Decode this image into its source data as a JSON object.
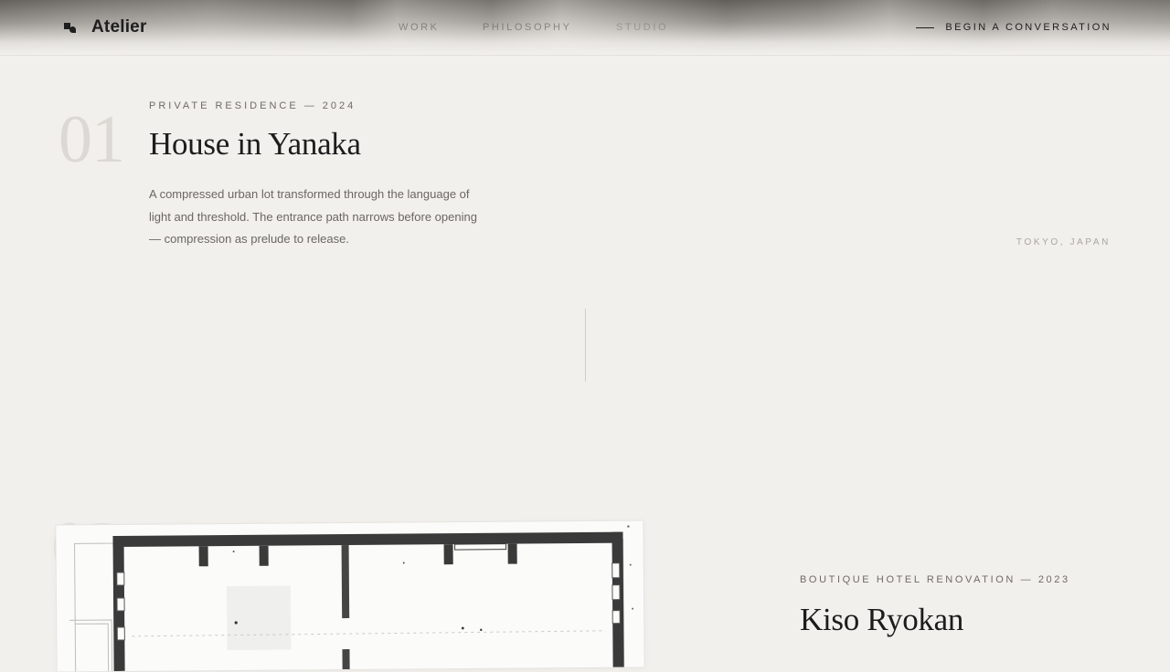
{
  "header": {
    "brand": "Atelier",
    "nav": [
      "WORK",
      "PHILOSOPHY",
      "STUDIO"
    ],
    "cta": "BEGIN A CONVERSATION"
  },
  "projects": [
    {
      "number": "01",
      "kicker": "PRIVATE RESIDENCE — 2024",
      "title": "House in Yanaka",
      "description": "A compressed urban lot transformed through the language of light and threshold. The entrance path narrows before opening — compression as prelude to release.",
      "location": "TOKYO, JAPAN"
    },
    {
      "number": "02",
      "kicker": "BOUTIQUE HOTEL RENOVATION — 2023",
      "title": "Kiso Ryokan"
    }
  ],
  "icons": {
    "logo": "logo-mark-icon"
  }
}
